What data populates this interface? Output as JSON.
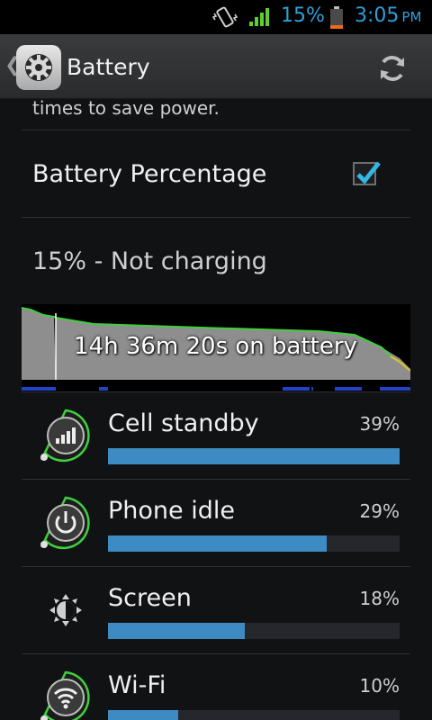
{
  "status_bar": {
    "battery_percent": "15%",
    "time": "3:05",
    "ampm": "PM"
  },
  "action_bar": {
    "title": "Battery",
    "back_icon": "chevron-left-icon",
    "app_icon": "settings-gear-icon",
    "refresh_icon": "refresh-icon"
  },
  "content": {
    "cut_text": "times to save power.",
    "battery_percentage_pref": {
      "title": "Battery Percentage",
      "checked": true
    },
    "status_text": "15% - Not charging",
    "graph_label": "14h 36m 20s on battery",
    "usage": [
      {
        "label": "Cell standby",
        "percent": "39%",
        "level": 1.0,
        "icon": "cell-signal-icon"
      },
      {
        "label": "Phone idle",
        "percent": "29%",
        "level": 0.75,
        "icon": "power-icon"
      },
      {
        "label": "Screen",
        "percent": "18%",
        "level": 0.47,
        "icon": "brightness-icon"
      },
      {
        "label": "Wi-Fi",
        "percent": "10%",
        "level": 0.24,
        "icon": "wifi-icon"
      }
    ]
  },
  "colors": {
    "accent": "#2f9fd8",
    "bar_fill": "#3e8ac2",
    "graph_line": "#3fcf3f"
  }
}
